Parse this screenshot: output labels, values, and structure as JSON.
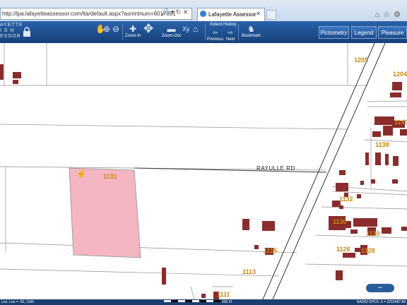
{
  "browser": {
    "address": "http://lpa.lafayetteassessor.com/lta/default.aspx?asmntnum=6017891",
    "tab_title": "Lafayette Assessor"
  },
  "app": {
    "brand_line1": "AYETTE",
    "brand_line2": "I S H",
    "brand_line3": "ESSOR"
  },
  "toolbar": {
    "zoom_in_label": "Zoom-In",
    "zoom_out_label": "Zoom-Out",
    "xy_label": "Xy",
    "extent_history_label": "Extent History",
    "previous_label": "Previous",
    "next_label": "Next",
    "bookmark_label": "Bookmark"
  },
  "panel_buttons": {
    "pictometry": "Pictometry",
    "legend": "Legend",
    "pleasure": "Pleasure"
  },
  "map": {
    "road_name": "RAYULLE RD",
    "selected_parcel": "1131",
    "parcel_labels": {
      "p1205": "1205",
      "p1204": "1204",
      "p1140": "1140",
      "p1138": "1138",
      "p1132": "1132",
      "p1130a": "1130",
      "p1130b": "1130",
      "p1126": "1126",
      "p1128": "1128",
      "p1115": "1115",
      "p1113": "1113",
      "p1111": "1111"
    },
    "colors": {
      "selected_fill": "#f4b6c2",
      "building": "#8b2c2c",
      "label": "#c98a10"
    }
  },
  "status": {
    "coords_left": "Lon, Lon = -92, 1160",
    "scale_text": "200 Ft",
    "coords_right": "NAD83 SPCS: X = 3215487.88"
  }
}
